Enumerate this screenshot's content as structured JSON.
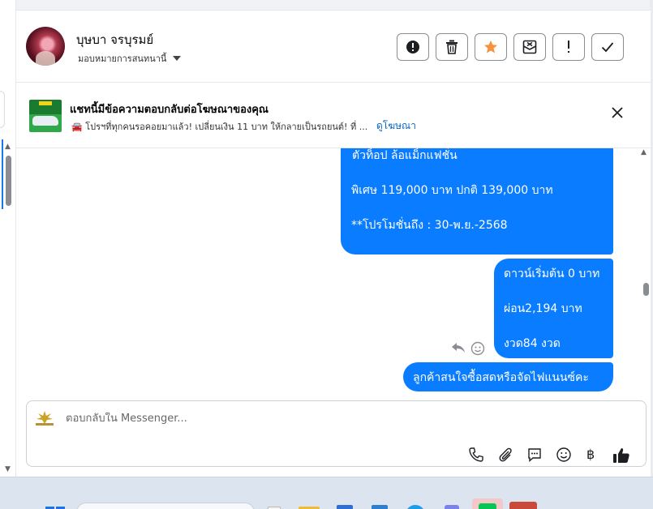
{
  "contact": {
    "name": "บุษบา จรบุรมย์",
    "assign_label": "มอบหมายการสนทนานี้"
  },
  "toolbar": {
    "buttons": [
      {
        "name": "spam-button",
        "icon": "exclamation-circle-icon"
      },
      {
        "name": "delete-button",
        "icon": "trash-icon"
      },
      {
        "name": "star-button",
        "icon": "star-icon",
        "color": "#f7923a"
      },
      {
        "name": "mark-unread-button",
        "icon": "envelope-x-icon"
      },
      {
        "name": "follow-up-button",
        "icon": "exclamation-icon"
      },
      {
        "name": "mark-done-button",
        "icon": "check-icon"
      }
    ]
  },
  "ad_banner": {
    "title": "แชทนี้มีข้อความตอบกลับต่อโฆษณาของคุณ",
    "subtitle": "🚘 โปรฯที่ทุกคนรอคอยมาแล้ว! เปลี่ยนเงิน 11 บาท ให้กลายเป็นรถยนต์! ที่ ...",
    "link_label": "ดูโฆษณา"
  },
  "messages": [
    {
      "lines": [
        " ตัวท็อป ล้อแม็กแฟชั่น",
        "พิเศษ 119,000 บาท  ปกติ 139,000 บาท",
        "**โปรโมชั่นถึง : 30-พ.ย.-2568"
      ]
    },
    {
      "lines": [
        "ดาวน์เริ่มต้น 0 บาท",
        "ผ่อน2,194 บาท",
        "งวด84 งวด"
      ]
    },
    {
      "lines": [
        "ลูกค้าสนใจซื้อสดหรือจัดไฟแนนซ์คะ"
      ]
    }
  ],
  "composer": {
    "placeholder": "ตอบกลับใน Messenger...",
    "currency_symbol": "฿"
  },
  "colors": {
    "accent": "#0a7cff",
    "link": "#0a66c2",
    "star": "#f7923a"
  }
}
